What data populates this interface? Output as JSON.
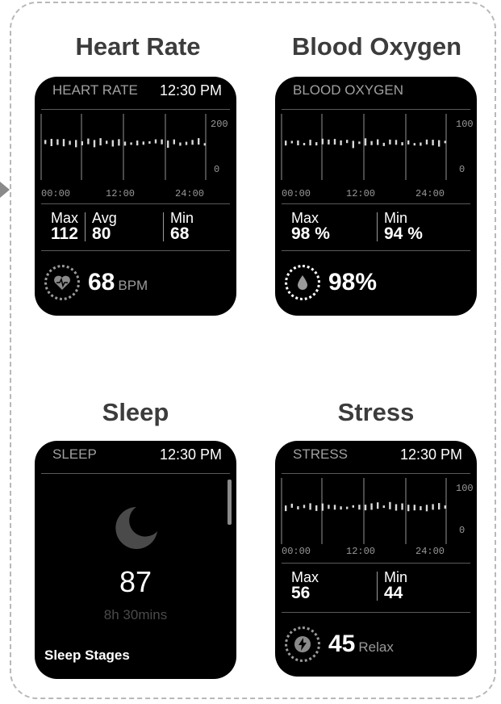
{
  "cards": {
    "heart": {
      "title": "Heart Rate",
      "header_label": "HEART RATE",
      "time": "12:30 PM",
      "y_ticks": [
        "200",
        "0"
      ],
      "x_ticks": [
        "00:00",
        "12:00",
        "24:00"
      ],
      "stats": [
        {
          "key": "Max",
          "value": "112"
        },
        {
          "key": "Avg",
          "value": "80"
        },
        {
          "key": "Min",
          "value": "68"
        }
      ],
      "big_value": "68",
      "unit": "BPM",
      "icon": "heart-pulse-icon"
    },
    "oxygen": {
      "title": "Blood Oxygen",
      "header_label": "BLOOD OXYGEN",
      "y_ticks": [
        "100",
        "0"
      ],
      "x_ticks": [
        "00:00",
        "12:00",
        "24:00"
      ],
      "stats": [
        {
          "key": "Max",
          "value": "98 %"
        },
        {
          "key": "Min",
          "value": "94 %"
        }
      ],
      "big_value": "98%",
      "icon": "droplet-icon"
    },
    "sleep": {
      "title": "Sleep",
      "header_label": "SLEEP",
      "time": "12:30 PM",
      "score": "87",
      "duration": "8h 30mins",
      "footer": "Sleep Stages",
      "icon": "moon-icon"
    },
    "stress": {
      "title": "Stress",
      "header_label": "STRESS",
      "time": "12:30 PM",
      "y_ticks": [
        "100",
        "0"
      ],
      "x_ticks": [
        "00:00",
        "12:00",
        "24:00"
      ],
      "stats": [
        {
          "key": "Max",
          "value": "56"
        },
        {
          "key": "Min",
          "value": "44"
        }
      ],
      "big_value": "45",
      "unit": "Relax",
      "icon": "lightning-icon"
    }
  },
  "colors": {
    "screen": "#000000",
    "muted_text": "#9a9a9a",
    "frame": "#b8b8b8",
    "title": "#3c3c3c"
  }
}
